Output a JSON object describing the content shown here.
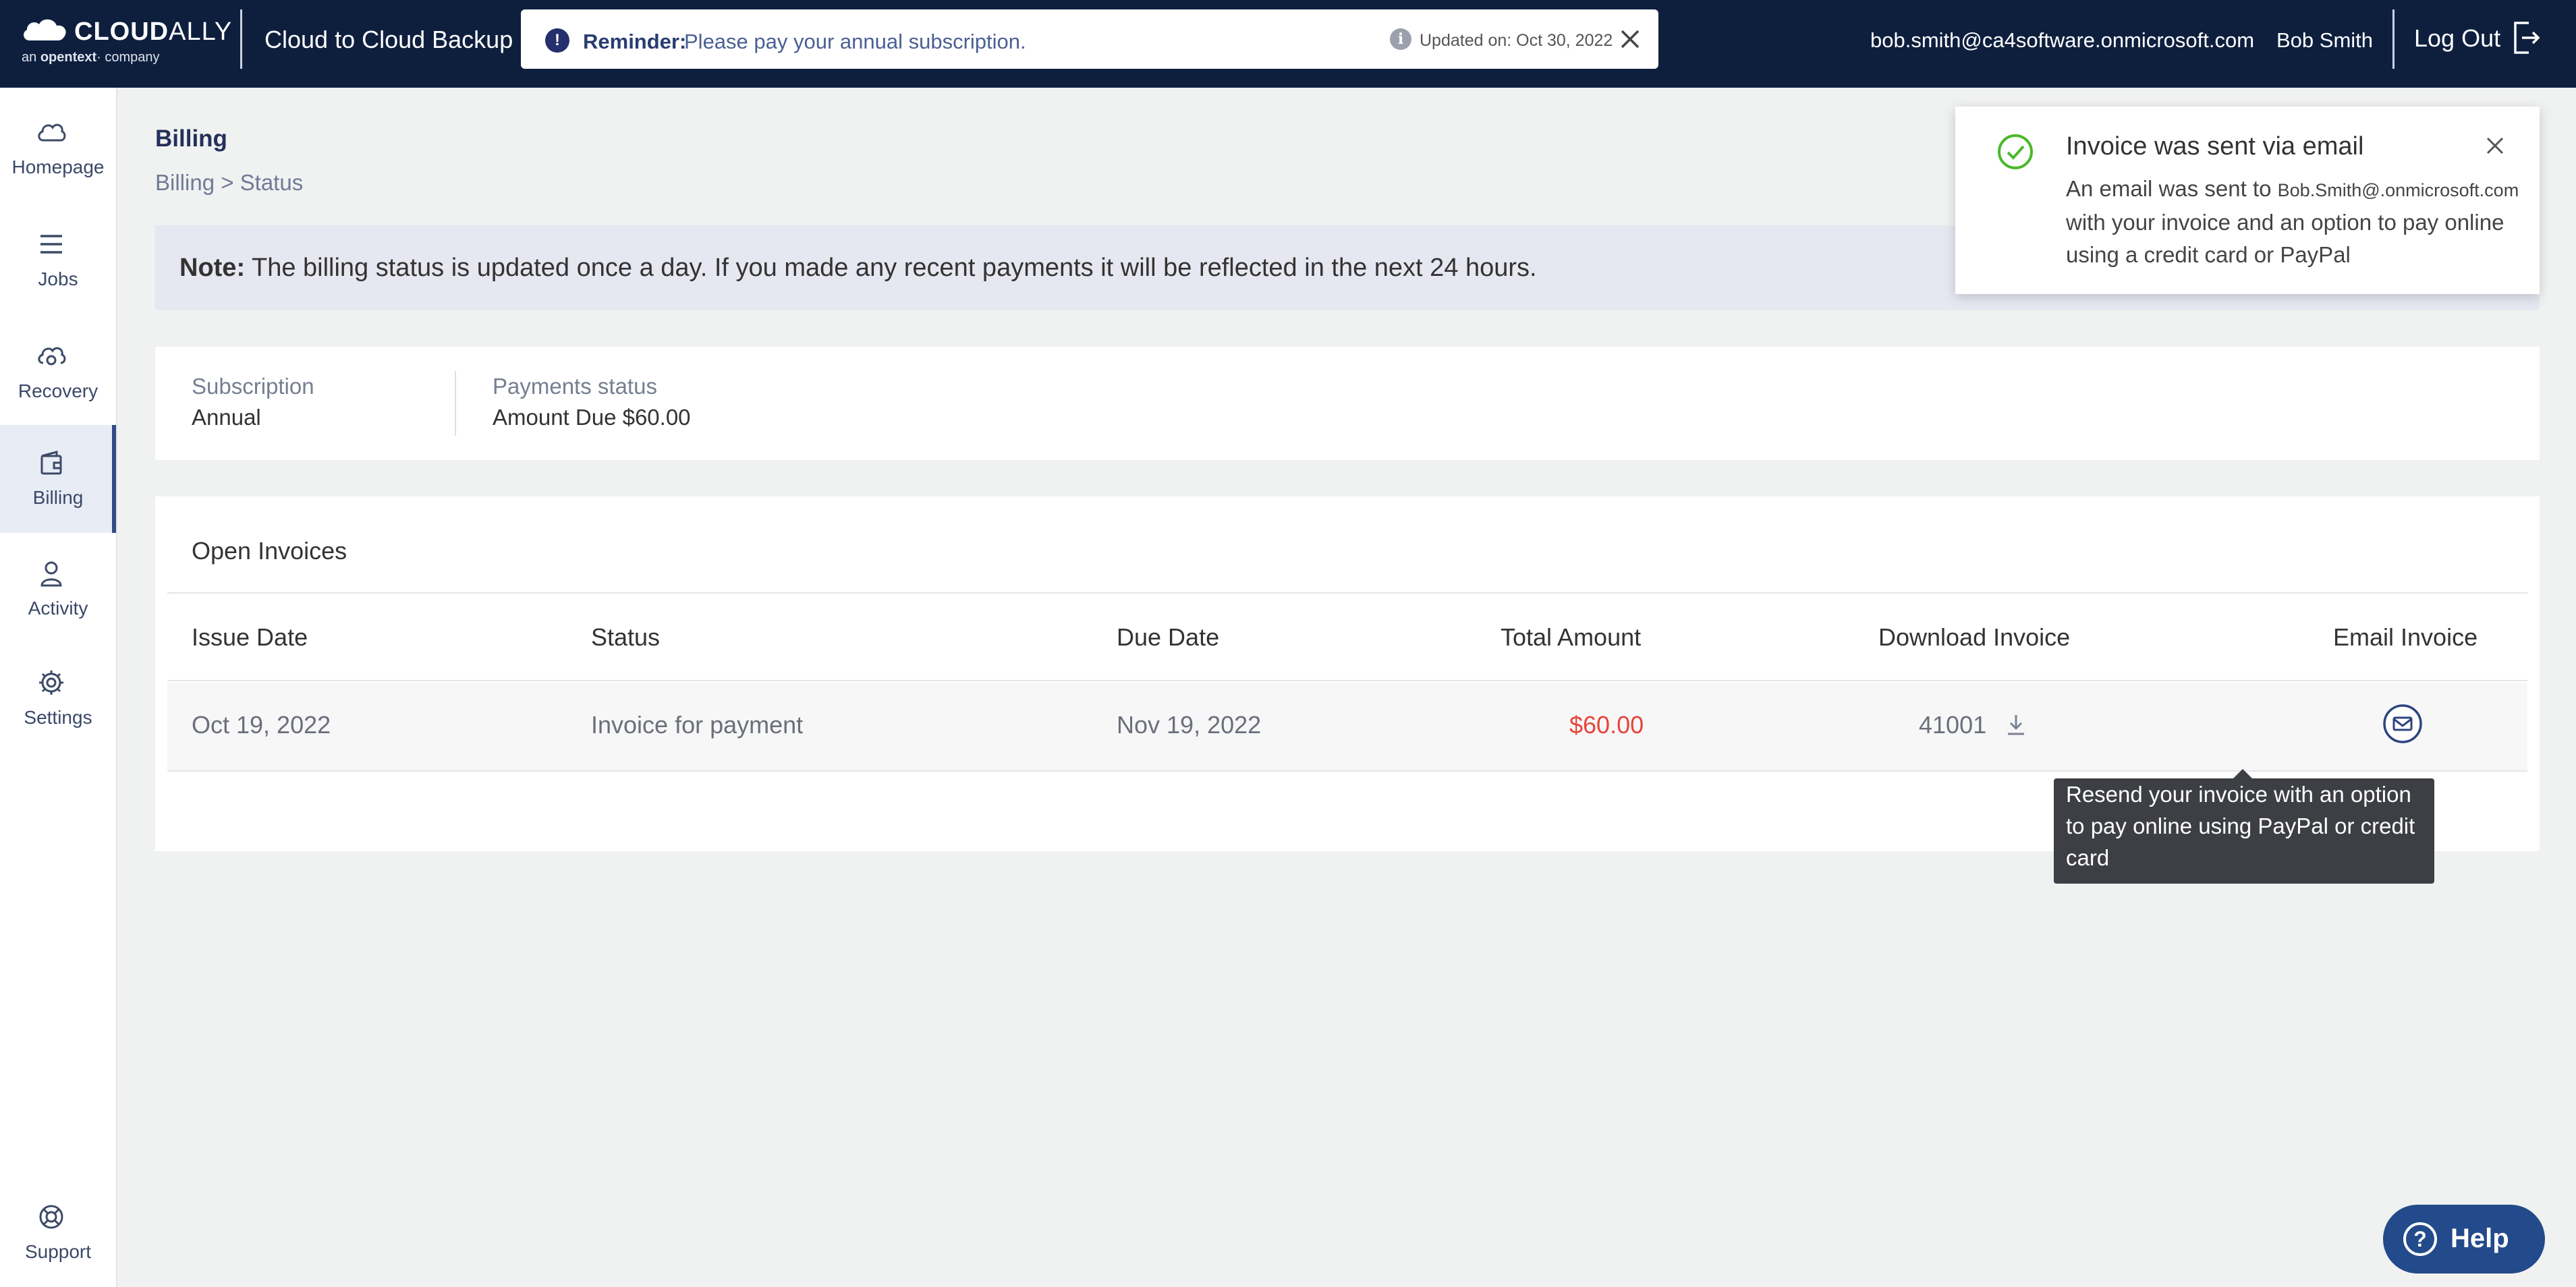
{
  "header": {
    "brand_main": "CLOUD",
    "brand_tail": "ALLY",
    "brand_sub_prefix": "an",
    "brand_sub_bold": "opentext",
    "brand_sub_suffix": "company",
    "app_title": "Cloud to Cloud Backup",
    "reminder_label": "Reminder:",
    "reminder_message": "Please pay your annual subscription.",
    "reminder_updated": "Updated on: Oct 30, 2022",
    "user_email": "bob.smith@ca4software.onmicrosoft.com",
    "user_name": "Bob Smith",
    "logout_label": "Log Out"
  },
  "sidebar": {
    "items": [
      {
        "label": "Homepage",
        "icon": "cloud-icon"
      },
      {
        "label": "Jobs",
        "icon": "list-icon"
      },
      {
        "label": "Recovery",
        "icon": "cloud-recovery-icon"
      },
      {
        "label": "Billing",
        "icon": "wallet-icon",
        "active": true
      },
      {
        "label": "Activity",
        "icon": "user-icon"
      },
      {
        "label": "Settings",
        "icon": "gear-icon"
      }
    ],
    "support_label": "Support"
  },
  "page": {
    "title": "Billing",
    "breadcrumb": "Billing > Status",
    "note_bold": "Note:",
    "note_text": "The billing status is updated once a day. If you made any recent payments it will be reflected in the next 24 hours."
  },
  "summary": {
    "subscription_label": "Subscription",
    "subscription_value": "Annual",
    "payments_label": "Payments status",
    "payments_value": "Amount Due $60.00"
  },
  "invoices": {
    "title": "Open Invoices",
    "columns": [
      "Issue Date",
      "Status",
      "Due Date",
      "Total Amount",
      "Download Invoice",
      "Email Invoice"
    ],
    "rows": [
      {
        "issue_date": "Oct 19, 2022",
        "status": "Invoice for payment",
        "due_date": "Nov 19, 2022",
        "total_amount": "$60.00",
        "invoice_number": "41001"
      }
    ],
    "tooltip": "Resend your invoice with an option to pay online using PayPal or credit card"
  },
  "toast": {
    "title": "Invoice was sent via email",
    "body_prefix": "An email was sent to",
    "email": "Bob.Smith@.onmicrosoft.com",
    "body_suffix": "with your invoice and an option to pay online using a credit card or PayPal"
  },
  "help": {
    "label": "Help"
  },
  "colors": {
    "header_bg": "#0e1f3e",
    "accent": "#234a8a",
    "amount_due": "#e8443a",
    "success": "#4cb82c"
  }
}
